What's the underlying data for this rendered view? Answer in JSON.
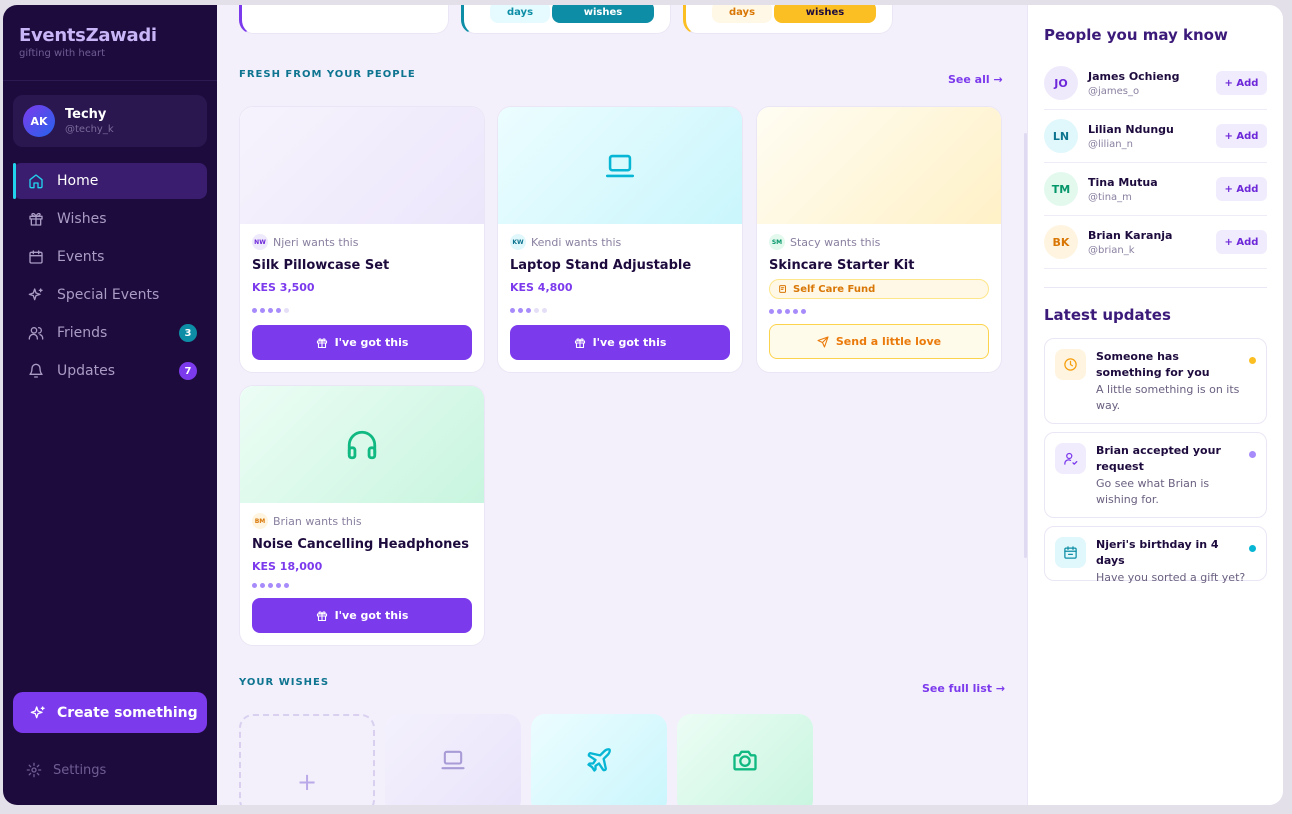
{
  "brand": {
    "title": "EventsZawadi",
    "tagline": "gifting with heart"
  },
  "user": {
    "initials": "AK",
    "name": "Techy",
    "handle": "@techy_k"
  },
  "nav": [
    {
      "label": "Home",
      "icon": "home-icon",
      "active": true
    },
    {
      "label": "Wishes",
      "icon": "gift-icon"
    },
    {
      "label": "Events",
      "icon": "calendar-icon"
    },
    {
      "label": "Special Events",
      "icon": "sparkles-icon"
    },
    {
      "label": "Friends",
      "icon": "users-icon",
      "badge": "3"
    },
    {
      "label": "Updates",
      "icon": "bell-icon",
      "badge": "7"
    }
  ],
  "create_label": "Create something",
  "settings_label": "Settings",
  "top_stubs": [
    {
      "pill_a": "",
      "pill_b": ""
    },
    {
      "pill_a": "days",
      "pill_b": "wishes"
    },
    {
      "pill_a": "days",
      "pill_b": "wishes"
    }
  ],
  "fresh": {
    "label": "FRESH FROM YOUR PEOPLE",
    "see_all": "See all →",
    "cards": [
      {
        "initials": "NW",
        "wants": "Njeri wants this",
        "title": "Silk Pillowcase Set",
        "price": "KES 3,500",
        "progress_dots": 4,
        "button": "I've got this",
        "icon": ""
      },
      {
        "initials": "KW",
        "wants": "Kendi wants this",
        "title": "Laptop Stand Adjustable",
        "price": "KES 4,800",
        "progress_dots": 3,
        "button": "I've got this",
        "icon": "laptop-icon"
      },
      {
        "initials": "SM",
        "wants": "Stacy wants this",
        "title": "Skincare Starter Kit",
        "fund": "Self Care Fund",
        "progress_dots": 5,
        "button": "Send a little love",
        "icon": ""
      },
      {
        "initials": "BM",
        "wants": "Brian wants this",
        "title": "Noise Cancelling Headphones",
        "price": "KES 18,000",
        "progress_dots": 5,
        "button": "I've got this",
        "icon": "headphones-icon"
      }
    ]
  },
  "wishes": {
    "label": "YOUR WISHES",
    "see_full": "See full list →",
    "add_symbol": "+"
  },
  "people": {
    "title": "People you may know",
    "add_label": "+ Add",
    "list": [
      {
        "initials": "JO",
        "name": "James Ochieng",
        "handle": "@james_o"
      },
      {
        "initials": "LN",
        "name": "Lilian Ndungu",
        "handle": "@lilian_n"
      },
      {
        "initials": "TM",
        "name": "Tina Mutua",
        "handle": "@tina_m"
      },
      {
        "initials": "BK",
        "name": "Brian Karanja",
        "handle": "@brian_k"
      }
    ]
  },
  "updates": {
    "title": "Latest updates",
    "list": [
      {
        "title": "Someone has something for you",
        "sub": "A little something is on its way."
      },
      {
        "title": "Brian accepted your request",
        "sub": "Go see what Brian is wishing for."
      },
      {
        "title": "Njeri's birthday in 4 days",
        "sub": "Have you sorted a gift yet?"
      }
    ]
  },
  "colors": {
    "accent": "#7c3aed",
    "sidebar": "#1e0b3e",
    "teal": "#0e7490",
    "amber": "#fbbf24"
  }
}
